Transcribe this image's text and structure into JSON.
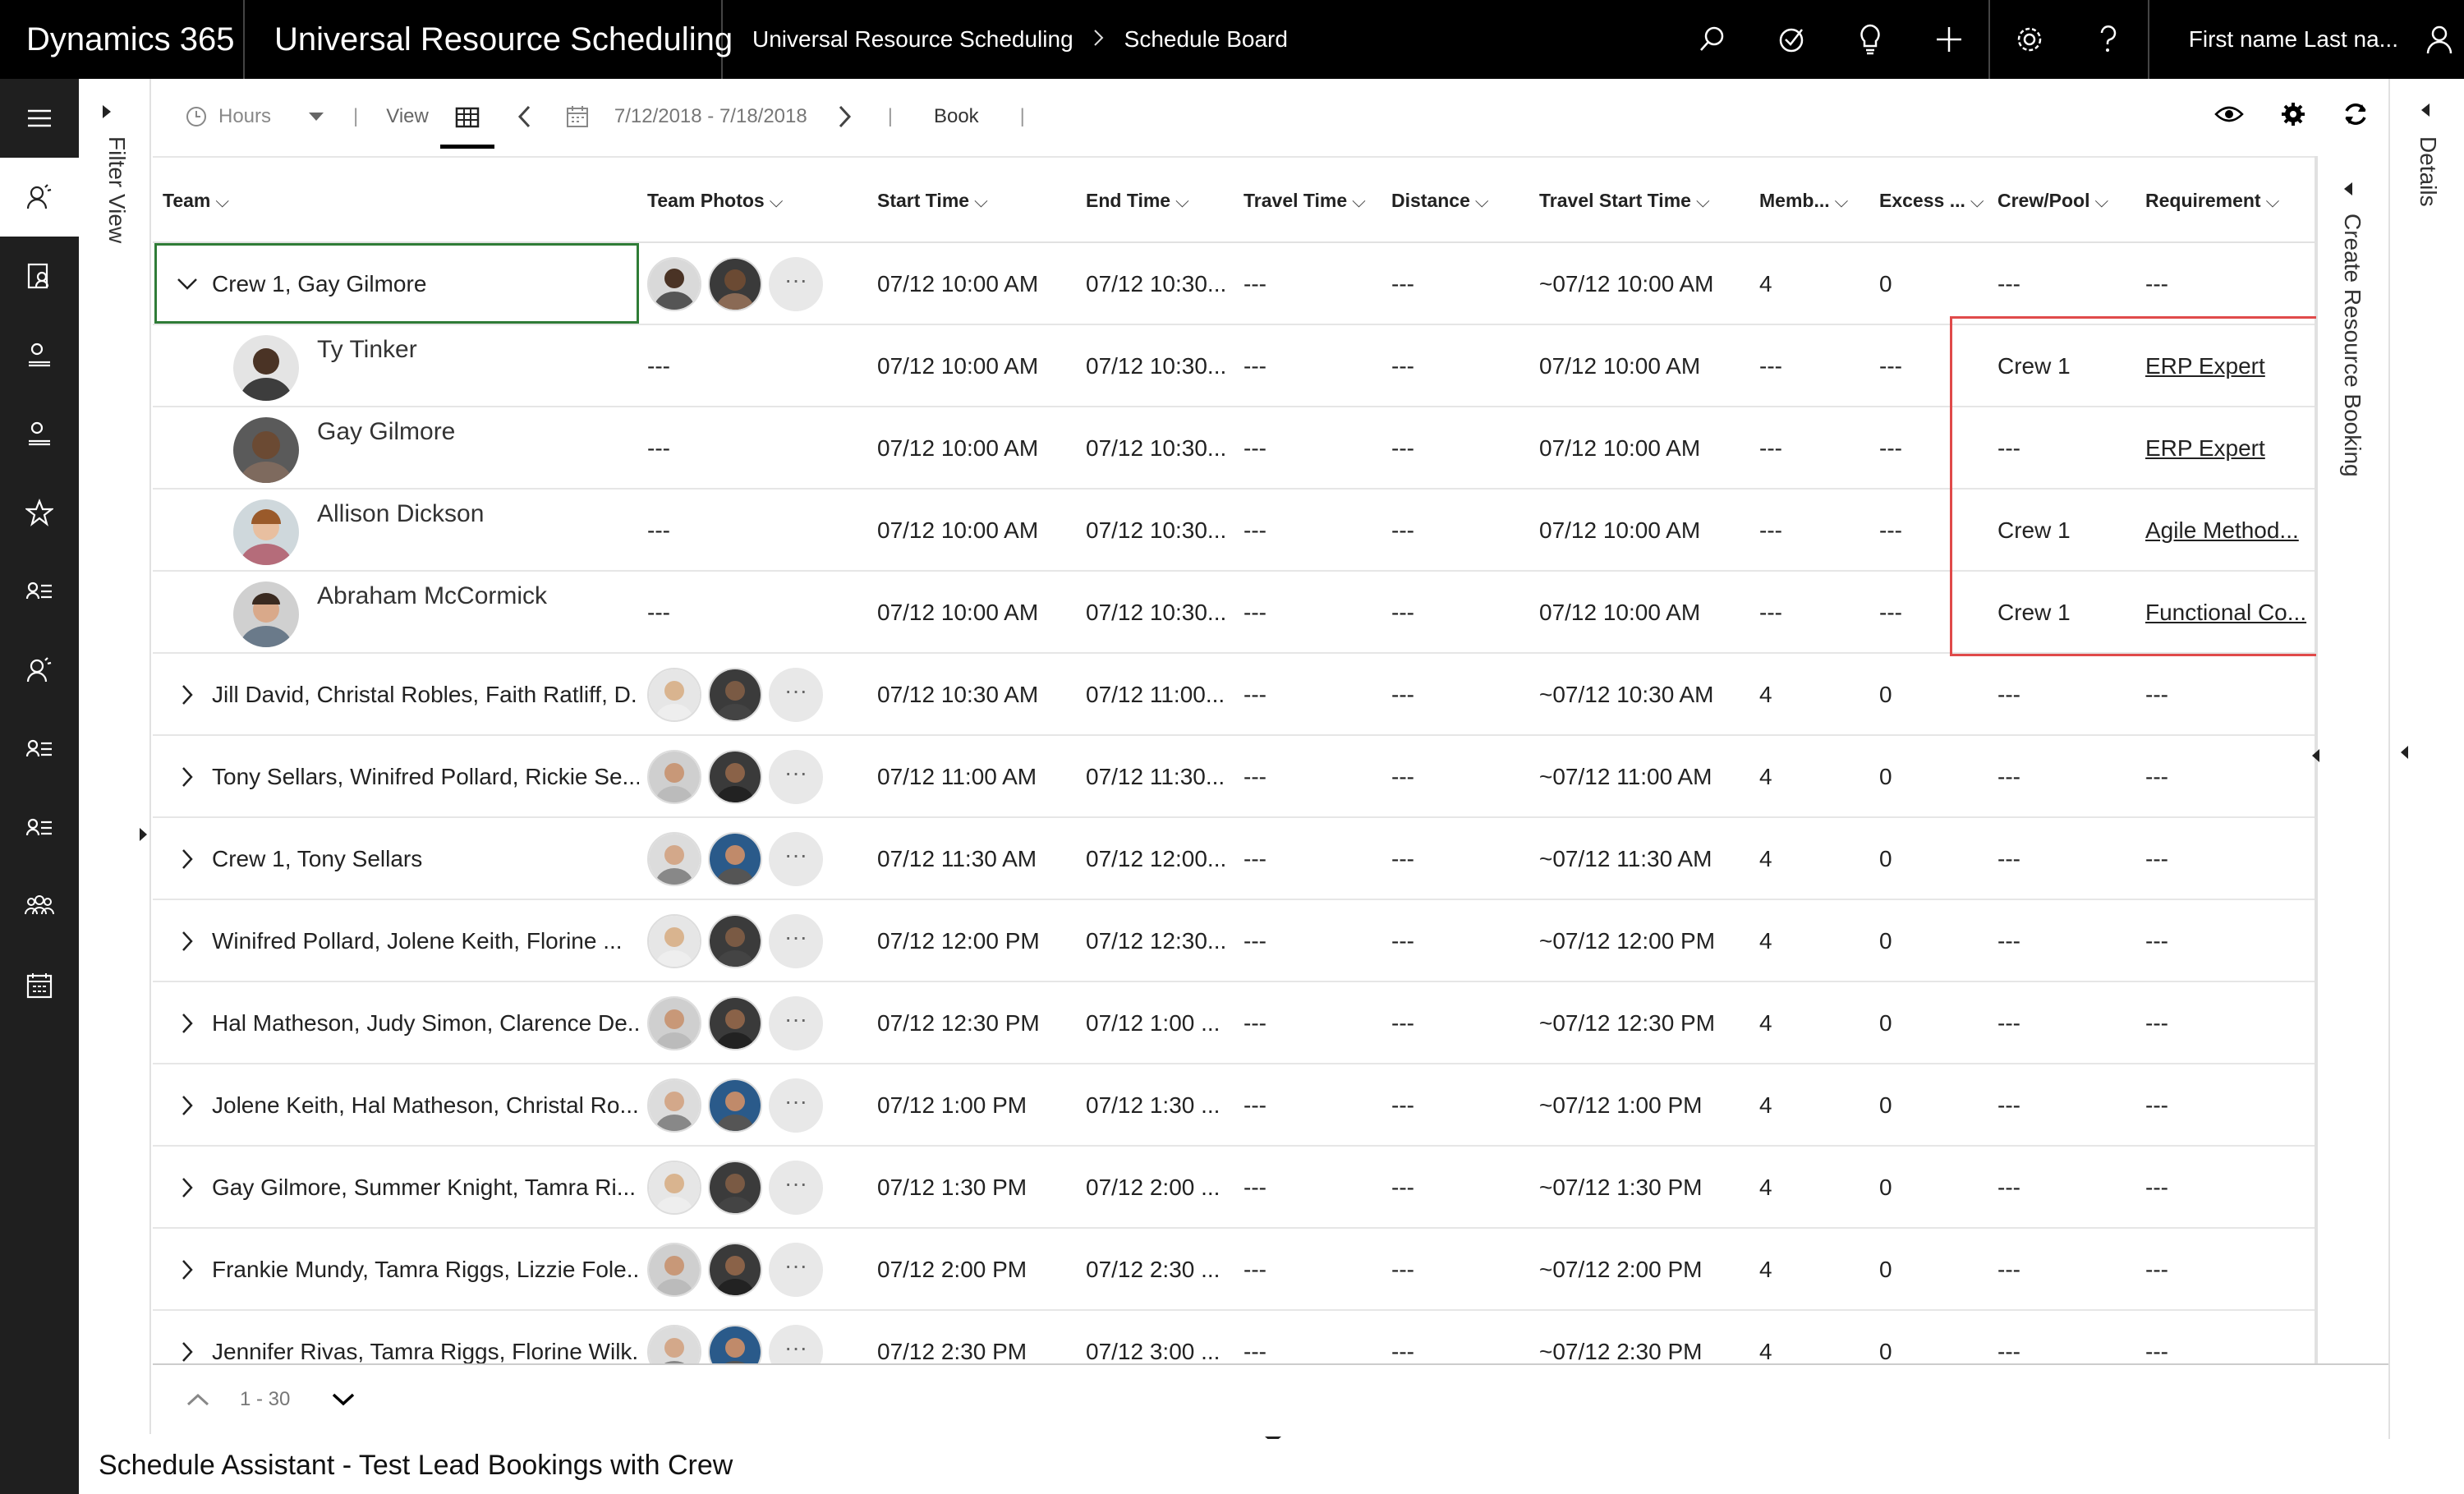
{
  "app": {
    "name": "Dynamics 365",
    "module": "Universal Resource Scheduling",
    "breadcrumb": [
      "Universal Resource Scheduling",
      "Schedule Board"
    ],
    "user": "First name Last na..."
  },
  "topbar_icons": [
    "search-icon",
    "task-check-icon",
    "lightbulb-icon",
    "plus-icon",
    "gear-icon",
    "help-icon",
    "user-icon"
  ],
  "filter_view": {
    "label": "Filter View"
  },
  "toolbar": {
    "hours_label": "Hours",
    "view_label": "View",
    "date_range": "7/12/2018 - 7/18/2018",
    "book_label": "Book"
  },
  "columns": [
    "Team",
    "Team Photos",
    "Start Time",
    "End Time",
    "Travel Time",
    "Distance",
    "Travel Start Time",
    "Memb...",
    "Excess ...",
    "Crew/Pool",
    "Requirement"
  ],
  "group_expanded": {
    "team": "Crew 1, Gay Gilmore",
    "start": "07/12 10:00 AM",
    "end": "07/12 10:30...",
    "travel_time": "---",
    "distance": "---",
    "travel_start": "~07/12 10:00 AM",
    "members": "4",
    "excess": "0",
    "crew": "---",
    "requirement": "---"
  },
  "members": [
    {
      "name": "Ty Tinker",
      "photos": "---",
      "start": "07/12 10:00 AM",
      "end": "07/12 10:30...",
      "travel_time": "---",
      "distance": "---",
      "travel_start": "07/12 10:00 AM",
      "members": "---",
      "excess": "---",
      "crew": "Crew 1",
      "requirement": "ERP Expert"
    },
    {
      "name": "Gay Gilmore",
      "photos": "---",
      "start": "07/12 10:00 AM",
      "end": "07/12 10:30...",
      "travel_time": "---",
      "distance": "---",
      "travel_start": "07/12 10:00 AM",
      "members": "---",
      "excess": "---",
      "crew": "---",
      "requirement": "ERP Expert"
    },
    {
      "name": "Allison Dickson",
      "photos": "---",
      "start": "07/12 10:00 AM",
      "end": "07/12 10:30...",
      "travel_time": "---",
      "distance": "---",
      "travel_start": "07/12 10:00 AM",
      "members": "---",
      "excess": "---",
      "crew": "Crew 1",
      "requirement": "Agile Method..."
    },
    {
      "name": "Abraham McCormick",
      "photos": "---",
      "start": "07/12 10:00 AM",
      "end": "07/12 10:30...",
      "travel_time": "---",
      "distance": "---",
      "travel_start": "07/12 10:00 AM",
      "members": "---",
      "excess": "---",
      "crew": "Crew 1",
      "requirement": "Functional Co..."
    }
  ],
  "groups": [
    {
      "team": "Jill David, Christal Robles, Faith Ratliff, D...",
      "start": "07/12 10:30 AM",
      "end": "07/12 11:00...",
      "travel_time": "---",
      "distance": "---",
      "travel_start": "~07/12 10:30 AM",
      "members": "4",
      "excess": "0",
      "crew": "---",
      "requirement": "---"
    },
    {
      "team": "Tony Sellars, Winifred Pollard, Rickie Se...",
      "start": "07/12 11:00 AM",
      "end": "07/12 11:30...",
      "travel_time": "---",
      "distance": "---",
      "travel_start": "~07/12 11:00 AM",
      "members": "4",
      "excess": "0",
      "crew": "---",
      "requirement": "---"
    },
    {
      "team": "Crew 1, Tony Sellars",
      "start": "07/12 11:30 AM",
      "end": "07/12 12:00...",
      "travel_time": "---",
      "distance": "---",
      "travel_start": "~07/12 11:30 AM",
      "members": "4",
      "excess": "0",
      "crew": "---",
      "requirement": "---"
    },
    {
      "team": "Winifred Pollard, Jolene Keith, Florine ...",
      "start": "07/12 12:00 PM",
      "end": "07/12 12:30...",
      "travel_time": "---",
      "distance": "---",
      "travel_start": "~07/12 12:00 PM",
      "members": "4",
      "excess": "0",
      "crew": "---",
      "requirement": "---"
    },
    {
      "team": "Hal Matheson, Judy Simon, Clarence De...",
      "start": "07/12 12:30 PM",
      "end": "07/12 1:00 ...",
      "travel_time": "---",
      "distance": "---",
      "travel_start": "~07/12 12:30 PM",
      "members": "4",
      "excess": "0",
      "crew": "---",
      "requirement": "---"
    },
    {
      "team": "Jolene Keith, Hal Matheson, Christal Ro...",
      "start": "07/12 1:00 PM",
      "end": "07/12 1:30 ...",
      "travel_time": "---",
      "distance": "---",
      "travel_start": "~07/12 1:00 PM",
      "members": "4",
      "excess": "0",
      "crew": "---",
      "requirement": "---"
    },
    {
      "team": "Gay Gilmore, Summer Knight, Tamra Ri...",
      "start": "07/12 1:30 PM",
      "end": "07/12 2:00 ...",
      "travel_time": "---",
      "distance": "---",
      "travel_start": "~07/12 1:30 PM",
      "members": "4",
      "excess": "0",
      "crew": "---",
      "requirement": "---"
    },
    {
      "team": "Frankie Mundy, Tamra Riggs, Lizzie Fole...",
      "start": "07/12 2:00 PM",
      "end": "07/12 2:30 ...",
      "travel_time": "---",
      "distance": "---",
      "travel_start": "~07/12 2:00 PM",
      "members": "4",
      "excess": "0",
      "crew": "---",
      "requirement": "---"
    },
    {
      "team": "Jennifer Rivas, Tamra Riggs, Florine Wilk...",
      "start": "07/12 2:30 PM",
      "end": "07/12 3:00 ...",
      "travel_time": "---",
      "distance": "---",
      "travel_start": "~07/12 2:30 PM",
      "members": "4",
      "excess": "0",
      "crew": "---",
      "requirement": "---"
    }
  ],
  "more_label": "···",
  "pager": {
    "range": "1 - 30"
  },
  "create_booking": {
    "label": "Create Resource Booking"
  },
  "details": {
    "label": "Details"
  },
  "caption": "Schedule Assistant - Test Lead Bookings with Crew",
  "colors": {
    "highlight": "#e04a4a",
    "selected_border": "#2f7c37",
    "topbar": "#000000",
    "leftnav": "#1f1f1f"
  }
}
